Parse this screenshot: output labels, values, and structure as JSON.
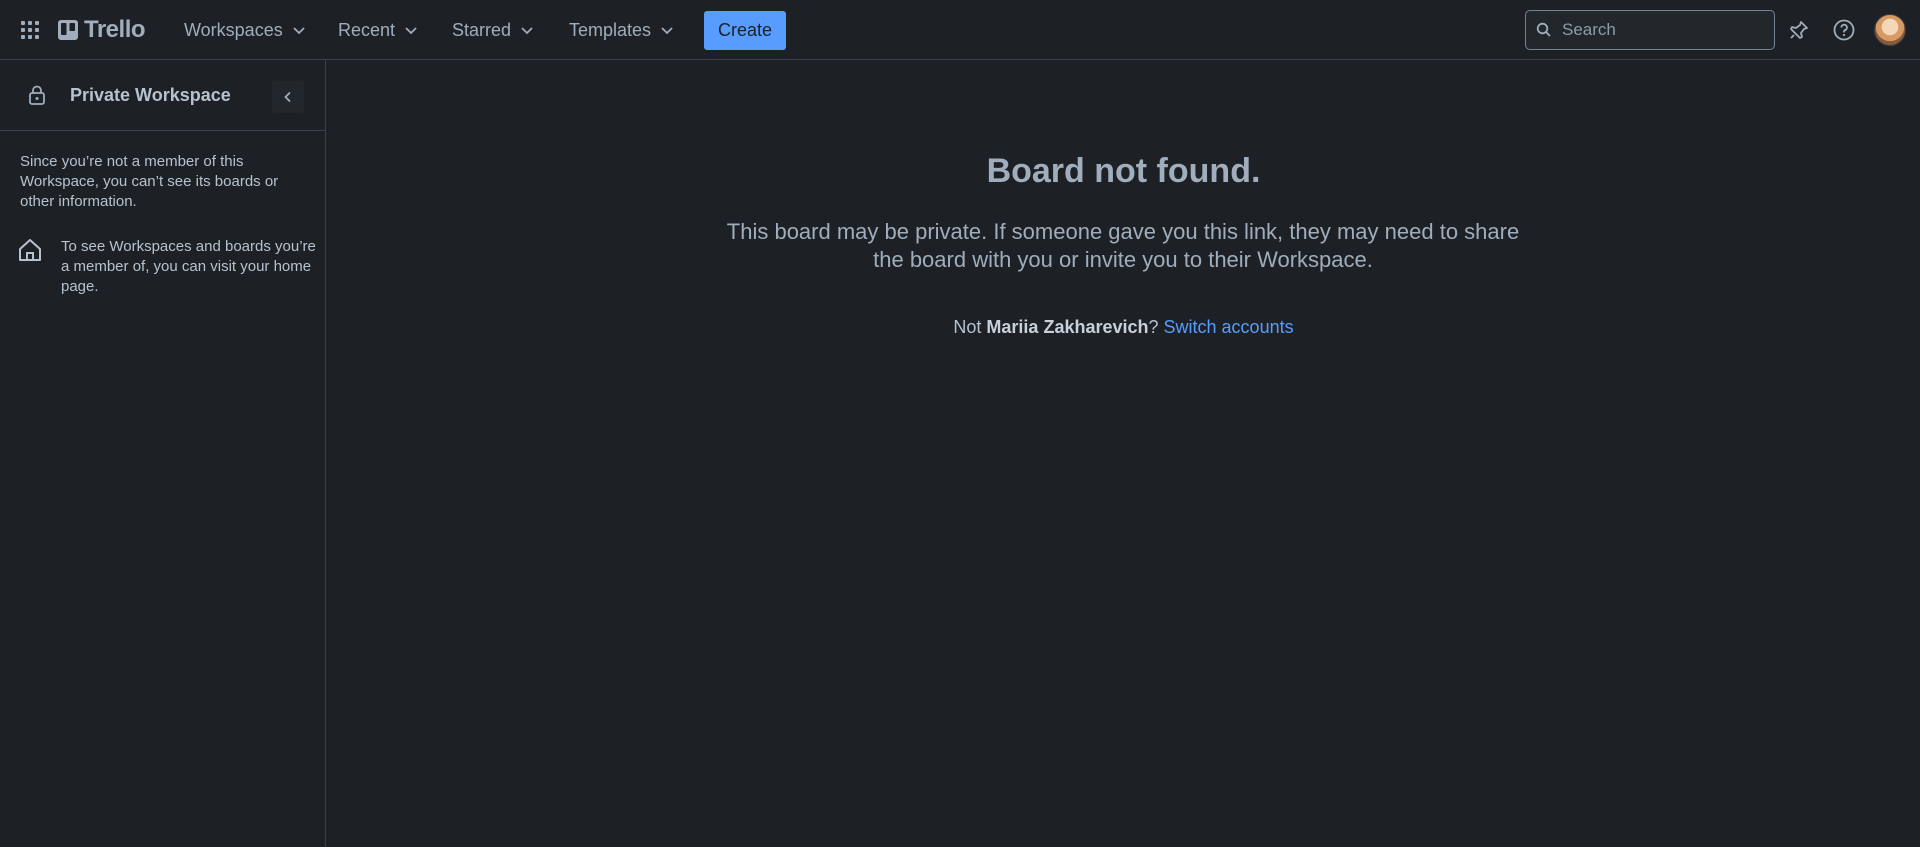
{
  "header": {
    "logo_text": "Trello",
    "nav": {
      "workspaces": "Workspaces",
      "recent": "Recent",
      "starred": "Starred",
      "templates": "Templates"
    },
    "create_label": "Create",
    "search_placeholder": "Search",
    "icons": [
      "app-switcher-icon",
      "trello-logo-icon",
      "chevron-down-icon",
      "search-icon",
      "notification-icon",
      "help-icon",
      "avatar"
    ]
  },
  "sidebar": {
    "workspace_title": "Private Workspace",
    "info_text": "Since you’re not a member of this Workspace, you can’t see its boards or other information.",
    "home_text": "To see Workspaces and boards you’re a member of, you can visit your home page."
  },
  "main": {
    "title": "Board not found.",
    "description": "This board may be private. If someone gave you this link, they may need to share the board with you or invite you to their Workspace.",
    "account_prefix": "Not ",
    "account_name": "Mariia Zakharevich",
    "account_suffix": "? ",
    "switch_label": "Switch accounts"
  },
  "colors": {
    "background": "#1d2125",
    "accent": "#579dff",
    "text": "#b6c2cf",
    "muted_text": "#9fadbc",
    "border": "#39424a"
  }
}
